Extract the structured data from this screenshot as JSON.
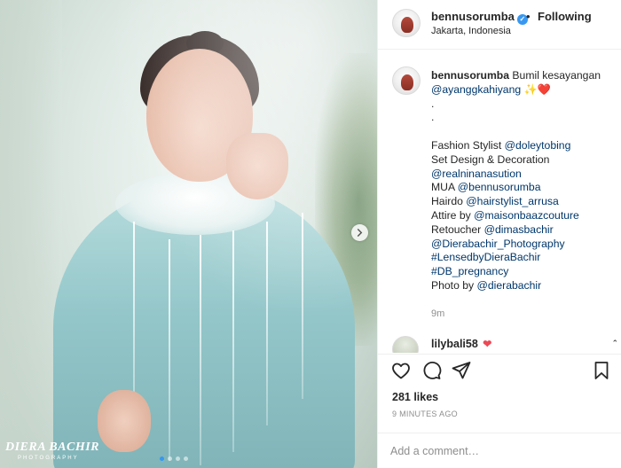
{
  "photo": {
    "watermark_title": "DIERA BACHIR",
    "watermark_subtitle": "PHOTOGRAPHY",
    "carousel_index": 1,
    "carousel_count": 4
  },
  "header": {
    "username": "bennusorumba",
    "separator": "•",
    "follow_status": "Following",
    "location": "Jakarta, Indonesia"
  },
  "caption": {
    "username": "bennusorumba",
    "first_line": "Bumil kesayangan",
    "mention_main": "@ayanggkahiyang",
    "emoji": "✨❤️",
    "dot1": ".",
    "dot2": ".",
    "lines": [
      {
        "prefix": "Fashion Stylist ",
        "link": "@doleytobing"
      },
      {
        "prefix": "Set Design & Decoration",
        "link": ""
      },
      {
        "prefix": "",
        "link": "@realninanasution"
      },
      {
        "prefix": "MUA ",
        "link": "@bennusorumba"
      },
      {
        "prefix": "Hairdo ",
        "link": "@hairstylist_arrusa"
      },
      {
        "prefix": "Attire by ",
        "link": "@maisonbaazcouture"
      },
      {
        "prefix": "Retoucher ",
        "link": "@dimasbachir"
      },
      {
        "prefix": "",
        "link": "@Dierabachir_Photography"
      },
      {
        "prefix": "",
        "link": "#LensedbyDieraBachir"
      },
      {
        "prefix": "",
        "link": "#DB_pregnancy"
      },
      {
        "prefix": "Photo by ",
        "link": "@dierabachir"
      }
    ],
    "time": "9m"
  },
  "comment": {
    "username": "lilybali58",
    "heart": "❤"
  },
  "likes": "281 likes",
  "posted": "9 MINUTES AGO",
  "add_comment": {
    "placeholder": "Add a comment…"
  },
  "colors": {
    "accent": "#3897f0",
    "link": "#00376b",
    "heart": "#ed4956",
    "muted": "#8e8e8e"
  },
  "icons": [
    "heart-icon",
    "comment-icon",
    "share-icon",
    "bookmark-icon",
    "verified-icon",
    "chevron-right-icon"
  ]
}
